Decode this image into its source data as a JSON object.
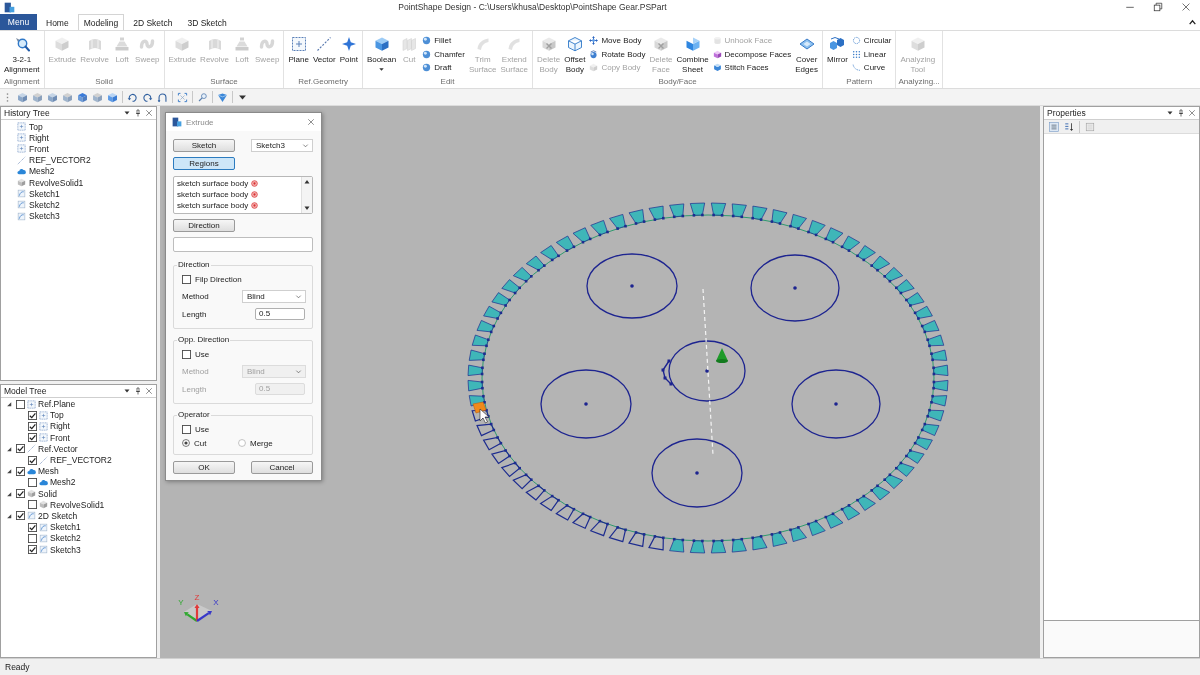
{
  "window": {
    "title": "PointShape Design - C:\\Users\\khusa\\Desktop\\PointShape Gear.PSPart"
  },
  "menu_button": {
    "label": "Menu"
  },
  "tabs": [
    {
      "label": "Home",
      "selected": false
    },
    {
      "label": "Modeling",
      "selected": true
    },
    {
      "label": "2D Sketch",
      "selected": false
    },
    {
      "label": "3D Sketch",
      "selected": false
    }
  ],
  "ribbon_groups": [
    {
      "label": "Alignment",
      "items": [
        {
          "kind": "large",
          "label": "3-2-1\nAlignment",
          "disabled": false
        }
      ]
    },
    {
      "label": "Solid",
      "items": [
        {
          "kind": "large",
          "label": "Extrude",
          "disabled": true
        },
        {
          "kind": "large",
          "label": "Revolve",
          "disabled": true
        },
        {
          "kind": "large",
          "label": "Loft",
          "disabled": true
        },
        {
          "kind": "large",
          "label": "Sweep",
          "disabled": true
        }
      ]
    },
    {
      "label": "Surface",
      "items": [
        {
          "kind": "large",
          "label": "Extrude",
          "disabled": true
        },
        {
          "kind": "large",
          "label": "Revolve",
          "disabled": true
        },
        {
          "kind": "large",
          "label": "Loft",
          "disabled": true
        },
        {
          "kind": "large",
          "label": "Sweep",
          "disabled": true
        }
      ]
    },
    {
      "label": "Ref.Geometry",
      "items": [
        {
          "kind": "large",
          "label": "Plane",
          "disabled": false
        },
        {
          "kind": "large",
          "label": "Vector",
          "disabled": false
        },
        {
          "kind": "large",
          "label": "Point",
          "disabled": false
        }
      ]
    },
    {
      "label": "Edit",
      "items": [
        {
          "kind": "split",
          "label": "Boolean",
          "disabled": false
        },
        {
          "kind": "large",
          "label": "Cut",
          "disabled": true
        },
        {
          "kind": "small",
          "label": "Fillet",
          "disabled": false
        },
        {
          "kind": "small",
          "label": "Chamfer",
          "disabled": false
        },
        {
          "kind": "small",
          "label": "Draft",
          "disabled": false
        },
        {
          "kind": "large",
          "label": "Trim\nSurface",
          "disabled": true
        },
        {
          "kind": "large",
          "label": "Extend\nSurface",
          "disabled": true
        }
      ]
    },
    {
      "label": "Body/Face",
      "items": [
        {
          "kind": "large",
          "label": "Delete\nBody",
          "disabled": true
        },
        {
          "kind": "large",
          "label": "Offset\nBody",
          "disabled": false
        },
        {
          "kind": "small",
          "label": "Move Body",
          "disabled": false
        },
        {
          "kind": "small",
          "label": "Rotate Body",
          "disabled": false
        },
        {
          "kind": "small",
          "label": "Copy Body",
          "disabled": true
        },
        {
          "kind": "large",
          "label": "Delete\nFace",
          "disabled": true
        },
        {
          "kind": "large",
          "label": "Combine\nSheet",
          "disabled": false
        },
        {
          "kind": "small",
          "label": "Unhook Face",
          "disabled": true
        },
        {
          "kind": "small",
          "label": "Decompose Faces",
          "disabled": false
        },
        {
          "kind": "small",
          "label": "Stitch Faces",
          "disabled": false
        },
        {
          "kind": "large",
          "label": "Cover\nEdges",
          "disabled": false
        }
      ]
    },
    {
      "label": "Pattern",
      "items": [
        {
          "kind": "large",
          "label": "Mirror",
          "disabled": false
        },
        {
          "kind": "small",
          "label": "Circular",
          "disabled": false
        },
        {
          "kind": "small",
          "label": "Linear",
          "disabled": false
        },
        {
          "kind": "small",
          "label": "Curve",
          "disabled": false
        }
      ]
    },
    {
      "label": "Analyzing...",
      "items": [
        {
          "kind": "large",
          "label": "Analyzing\nTool",
          "disabled": true
        }
      ]
    }
  ],
  "history_tree": {
    "title": "History Tree",
    "items": [
      {
        "kind": "plane",
        "label": "Top"
      },
      {
        "kind": "plane",
        "label": "Right"
      },
      {
        "kind": "plane",
        "label": "Front"
      },
      {
        "kind": "vector",
        "label": "REF_VECTOR2"
      },
      {
        "kind": "mesh",
        "label": "Mesh2"
      },
      {
        "kind": "solid",
        "label": "RevolveSolid1"
      },
      {
        "kind": "sketch",
        "label": "Sketch1"
      },
      {
        "kind": "sketch",
        "label": "Sketch2"
      },
      {
        "kind": "sketch",
        "label": "Sketch3"
      }
    ]
  },
  "model_tree": {
    "title": "Model Tree",
    "items": [
      {
        "kind": "plane",
        "label": "Ref.Plane",
        "checked": false,
        "expanded": true,
        "children": [
          {
            "kind": "plane",
            "label": "Top",
            "checked": true
          },
          {
            "kind": "plane",
            "label": "Right",
            "checked": true
          },
          {
            "kind": "plane",
            "label": "Front",
            "checked": true
          }
        ]
      },
      {
        "kind": "vector",
        "label": "Ref.Vector",
        "checked": true,
        "expanded": true,
        "children": [
          {
            "kind": "vector",
            "label": "REF_VECTOR2",
            "checked": true
          }
        ]
      },
      {
        "kind": "mesh",
        "label": "Mesh",
        "checked": true,
        "expanded": true,
        "children": [
          {
            "kind": "mesh",
            "label": "Mesh2",
            "checked": false
          }
        ]
      },
      {
        "kind": "solid",
        "label": "Solid",
        "checked": true,
        "expanded": true,
        "children": [
          {
            "kind": "solid",
            "label": "RevolveSolid1",
            "checked": false
          }
        ]
      },
      {
        "kind": "sketch",
        "label": "2D Sketch",
        "checked": true,
        "expanded": true,
        "children": [
          {
            "kind": "sketch",
            "label": "Sketch1",
            "checked": true
          },
          {
            "kind": "sketch",
            "label": "Sketch2",
            "checked": false
          },
          {
            "kind": "sketch",
            "label": "Sketch3",
            "checked": true
          }
        ]
      }
    ]
  },
  "dialog": {
    "title": "Extrude",
    "sketch_button": {
      "label": "Sketch",
      "selected": false
    },
    "sketch_select": {
      "value": "Sketch3"
    },
    "regions_button": {
      "label": "Regions",
      "selected": true
    },
    "regions_list": [
      "sketch surface body",
      "sketch surface body",
      "sketch surface body"
    ],
    "direction_button": {
      "label": "Direction",
      "selected": false
    },
    "groups": [
      {
        "title": "Direction",
        "check": {
          "label": "Filp Direction",
          "checked": false
        },
        "method": {
          "label": "Method",
          "value": "Blind",
          "disabled": false
        },
        "length": {
          "label": "Length",
          "value": "0.5",
          "disabled": false
        }
      },
      {
        "title": "Opp. Direction",
        "check": {
          "label": "Use",
          "checked": false
        },
        "method": {
          "label": "Method",
          "value": "Blind",
          "disabled": true
        },
        "length": {
          "label": "Length",
          "value": "0.5",
          "disabled": true
        }
      },
      {
        "title": "Operator",
        "check": {
          "label": "Use",
          "checked": false
        },
        "radios": [
          {
            "label": "Cut",
            "selected": true
          },
          {
            "label": "Merge",
            "selected": false
          }
        ]
      }
    ],
    "buttons": [
      "OK",
      "Cancel"
    ]
  },
  "viewport": {
    "axes": [
      {
        "label": "Y",
        "color": "#2fa82f"
      },
      {
        "label": "Z",
        "color": "#e03a3a"
      },
      {
        "label": "X",
        "color": "#3838c8"
      }
    ]
  },
  "properties": {
    "title": "Properties"
  },
  "status_bar": {
    "text": "Ready"
  }
}
